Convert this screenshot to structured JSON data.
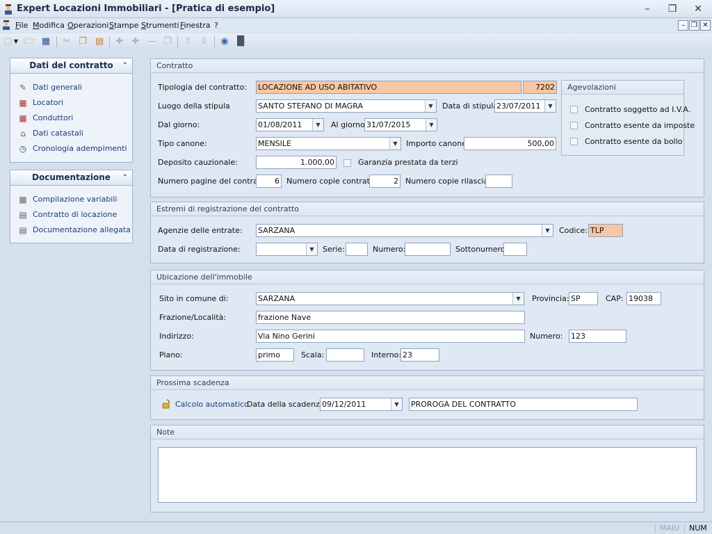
{
  "window": {
    "title": "Expert Locazioni Immobiliari - [Pratica di esempio]"
  },
  "menu": [
    "File",
    "Modifica",
    "Operazioni",
    "Stampe",
    "Strumenti",
    "Finestra",
    "?"
  ],
  "nav": {
    "contratto": {
      "title": "Dati del contratto",
      "items": [
        "Dati generali",
        "Locatori",
        "Conduttori",
        "Dati catastali",
        "Cronologia adempimenti"
      ]
    },
    "documentazione": {
      "title": "Documentazione",
      "items": [
        "Compilazione variabili",
        "Contratto di locazione",
        "Documentazione allegata"
      ]
    }
  },
  "contratto": {
    "title": "Contratto",
    "tipologia_label": "Tipologia del contratto:",
    "tipologia_value": "LOCAZIONE AD USO ABITATIVO",
    "tipologia_code": "7202",
    "luogo_label": "Luogo della stipula",
    "luogo_value": "SANTO STEFANO DI MAGRA",
    "data_stipula_label": "Data di stipula:",
    "data_stipula_value": "23/07/2011",
    "dal_label": "Dal giorno:",
    "dal_value": "01/08/2011",
    "al_label": "Al giorno:",
    "al_value": "31/07/2015",
    "tipo_canone_label": "Tipo canone:",
    "tipo_canone_value": "MENSILE",
    "importo_label": "Importo canone:",
    "importo_value": "500,00",
    "deposito_label": "Deposito cauzionale:",
    "deposito_value": "1.000,00",
    "garanzia_label": "Garanzia prestata da terzi",
    "pagine_label": "Numero pagine del contratto:",
    "pagine_value": "6",
    "copie_label": "Numero copie contratto:",
    "copie_value": "2",
    "rilasciate_label": "Numero copie rilasciate",
    "rilasciate_value": "",
    "agevolazioni": {
      "title": "Agevolazioni",
      "iva": "Contratto soggetto ad I.V.A.",
      "imposte": "Contratto esente da imposte",
      "bollo": "Contratto esente da bollo"
    }
  },
  "registrazione": {
    "title": "Estremi di registrazione del contratto",
    "agenzia_label": "Agenzie delle entrate:",
    "agenzia_value": "SARZANA",
    "codice_label": "Codice:",
    "codice_value": "TLP",
    "data_label": "Data di registrazione:",
    "data_value": "",
    "serie_label": "Serie:",
    "serie_value": "",
    "numero_label": "Numero:",
    "numero_value": "",
    "sotto_label": "Sottonumero:",
    "sotto_value": ""
  },
  "ubicazione": {
    "title": "Ubicazione dell'immobile",
    "comune_label": "Sito in comune di:",
    "comune_value": "SARZANA",
    "provincia_label": "Provincia:",
    "provincia_value": "SP",
    "cap_label": "CAP:",
    "cap_value": "19038",
    "frazione_label": "Frazione/Località:",
    "frazione_value": "frazione Nave",
    "indirizzo_label": "Indirizzo:",
    "indirizzo_value": "Via Nino Gerini",
    "numero_label": "Numero:",
    "numero_value": "123",
    "piano_label": "Piano:",
    "piano_value": "primo",
    "scala_label": "Scala:",
    "scala_value": "",
    "interno_label": "Interno:",
    "interno_value": "23"
  },
  "scadenza": {
    "title": "Prossima scadenza",
    "calcolo_label": "Calcolo automatico",
    "data_label": "Data della scadenza:",
    "data_value": "09/12/2011",
    "descrizione": "PROROGA DEL CONTRATTO"
  },
  "note": {
    "title": "Note",
    "value": ""
  },
  "status": {
    "caps": "MAIU",
    "num": "NUM"
  }
}
